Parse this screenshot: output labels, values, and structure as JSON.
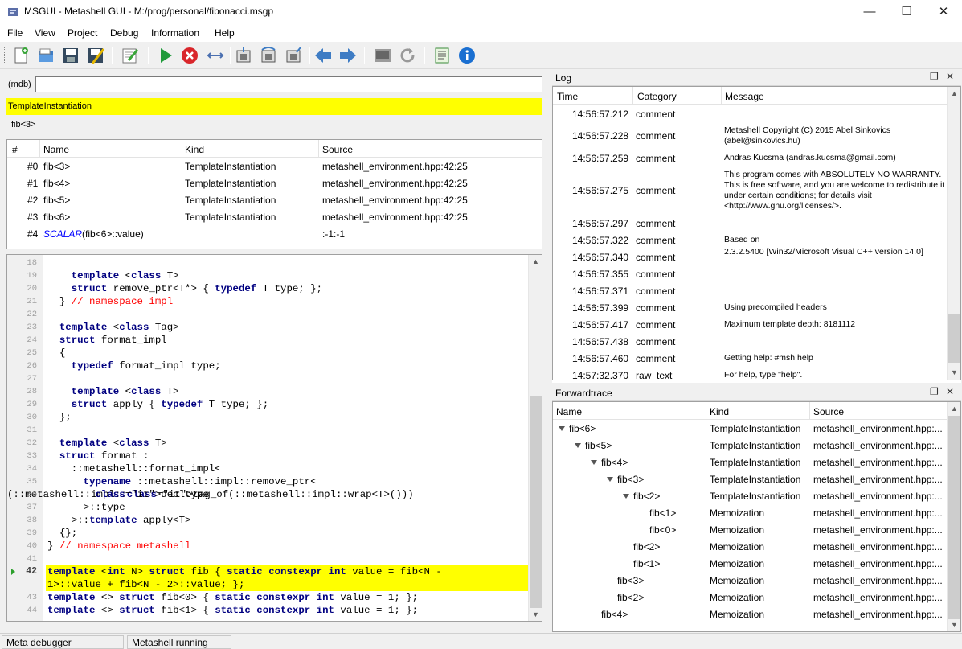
{
  "window": {
    "title": "MSGUI - Metashell GUI - M:/prog/personal/fibonacci.msgp"
  },
  "menu": [
    "File",
    "View",
    "Project",
    "Debug",
    "Information",
    "Help"
  ],
  "toolbar": {
    "icons": [
      "new-file-icon",
      "open-file-icon",
      "save-icon",
      "save-as-icon",
      "edit-icon",
      "run-icon",
      "stop-icon",
      "step-icon",
      "step-into-icon",
      "step-over-icon",
      "step-out-icon",
      "back-icon",
      "forward-icon",
      "terminal-icon",
      "refresh-icon",
      "notes-icon",
      "info-icon"
    ]
  },
  "mdb": {
    "label": "(mdb)",
    "value": ""
  },
  "current": {
    "kind": "TemplateInstantiation",
    "name": "fib<3>"
  },
  "frames": {
    "headers": [
      "#",
      "Name",
      "Kind",
      "Source"
    ],
    "rows": [
      {
        "idx": "#0",
        "name": "fib<3>",
        "kind": "TemplateInstantiation",
        "source": "metashell_environment.hpp:42:25"
      },
      {
        "idx": "#1",
        "name": "fib<4>",
        "kind": "TemplateInstantiation",
        "source": "metashell_environment.hpp:42:25"
      },
      {
        "idx": "#2",
        "name": "fib<5>",
        "kind": "TemplateInstantiation",
        "source": "metashell_environment.hpp:42:25"
      },
      {
        "idx": "#3",
        "name": "fib<6>",
        "kind": "TemplateInstantiation",
        "source": "metashell_environment.hpp:42:25"
      }
    ],
    "last_row": {
      "idx": "#4",
      "scalar": "SCALAR",
      "rest": "(fib<6>::value)",
      "source": ":-1:-1"
    }
  },
  "code": {
    "active_line": "42",
    "lines": [
      {
        "n": "18",
        "t": ""
      },
      {
        "n": "19",
        "t": "    template <class T>"
      },
      {
        "n": "20",
        "t": "    struct remove_ptr<T*> { typedef T type; };"
      },
      {
        "n": "21",
        "t": "  } // namespace impl"
      },
      {
        "n": "22",
        "t": ""
      },
      {
        "n": "23",
        "t": "  template <class Tag>"
      },
      {
        "n": "24",
        "t": "  struct format_impl"
      },
      {
        "n": "25",
        "t": "  {"
      },
      {
        "n": "26",
        "t": "    typedef format_impl type;"
      },
      {
        "n": "27",
        "t": ""
      },
      {
        "n": "28",
        "t": "    template <class T>"
      },
      {
        "n": "29",
        "t": "    struct apply { typedef T type; };"
      },
      {
        "n": "30",
        "t": "  };"
      },
      {
        "n": "31",
        "t": ""
      },
      {
        "n": "32",
        "t": "  template <class T>"
      },
      {
        "n": "33",
        "t": "  struct format :"
      },
      {
        "n": "34",
        "t": "    ::metashell::format_impl<"
      },
      {
        "n": "35",
        "t": "      typename ::metashell::impl::remove_ptr<"
      },
      {
        "n": "36",
        "t": "        decltype(::metashell::impl::tag_of(::metashell::impl::wrap<T>()))"
      },
      {
        "n": "37",
        "t": "      >::type"
      },
      {
        "n": "38",
        "t": "    >::template apply<T>"
      },
      {
        "n": "39",
        "t": "  {};"
      },
      {
        "n": "40",
        "t": "} // namespace metashell"
      },
      {
        "n": "41",
        "t": ""
      },
      {
        "n": "42",
        "t": "template <int N> struct fib { static constexpr int value = fib<N -"
      },
      {
        "n": "",
        "t": "1>::value + fib<N - 2>::value; };"
      },
      {
        "n": "43",
        "t": "template <> struct fib<0> { static constexpr int value = 1; };"
      },
      {
        "n": "44",
        "t": "template <> struct fib<1> { static constexpr int value = 1; };"
      }
    ]
  },
  "status": {
    "left": "Meta debugger",
    "right": "Metashell running"
  },
  "log": {
    "title": "Log",
    "headers": [
      "Time",
      "Category",
      "Message"
    ],
    "rows": [
      {
        "time": "14:56:57.212",
        "cat": "comment",
        "msg": ""
      },
      {
        "time": "14:56:57.228",
        "cat": "comment",
        "msg": "Metashell Copyright (C) 2015 Abel Sinkovics (abel@sinkovics.hu)"
      },
      {
        "time": "14:56:57.259",
        "cat": "comment",
        "msg": "Andras Kucsma  (andras.kucsma@gmail.com)"
      },
      {
        "time": "14:56:57.275",
        "cat": "comment",
        "msg": "This program comes with ABSOLUTELY NO WARRANTY. This is free software, and you are welcome to redistribute it under certain conditions; for details visit <http://www.gnu.org/licenses/>."
      },
      {
        "time": "14:56:57.297",
        "cat": "comment",
        "msg": ""
      },
      {
        "time": "14:56:57.322",
        "cat": "comment",
        "msg": "Based on"
      },
      {
        "time": "14:56:57.340",
        "cat": "comment",
        "msg": "2.3.2.5400 [Win32/Microsoft Visual C++ version 14.0]"
      },
      {
        "time": "14:56:57.355",
        "cat": "comment",
        "msg": ""
      },
      {
        "time": "14:56:57.371",
        "cat": "comment",
        "msg": ""
      },
      {
        "time": "14:56:57.399",
        "cat": "comment",
        "msg": "Using precompiled headers"
      },
      {
        "time": "14:56:57.417",
        "cat": "comment",
        "msg": "Maximum template depth: 8181112"
      },
      {
        "time": "14:56:57.438",
        "cat": "comment",
        "msg": ""
      },
      {
        "time": "14:56:57.460",
        "cat": "comment",
        "msg": "Getting help: #msh help"
      },
      {
        "time": "14:57:32.370",
        "cat": "raw_text",
        "msg": "For help, type \"help\"."
      }
    ]
  },
  "forwardtrace": {
    "title": "Forwardtrace",
    "headers": [
      "Name",
      "Kind",
      "Source"
    ],
    "rows": [
      {
        "name": "fib<6>",
        "kind": "TemplateInstantiation",
        "source": "metashell_environment.hpp:...",
        "depth": 0,
        "exp": true
      },
      {
        "name": "fib<5>",
        "kind": "TemplateInstantiation",
        "source": "metashell_environment.hpp:...",
        "depth": 1,
        "exp": true
      },
      {
        "name": "fib<4>",
        "kind": "TemplateInstantiation",
        "source": "metashell_environment.hpp:...",
        "depth": 2,
        "exp": true
      },
      {
        "name": "fib<3>",
        "kind": "TemplateInstantiation",
        "source": "metashell_environment.hpp:...",
        "depth": 3,
        "exp": true
      },
      {
        "name": "fib<2>",
        "kind": "TemplateInstantiation",
        "source": "metashell_environment.hpp:...",
        "depth": 4,
        "exp": true
      },
      {
        "name": "fib<1>",
        "kind": "Memoization",
        "source": "metashell_environment.hpp:...",
        "depth": 5,
        "exp": false
      },
      {
        "name": "fib<0>",
        "kind": "Memoization",
        "source": "metashell_environment.hpp:...",
        "depth": 5,
        "exp": false
      },
      {
        "name": "fib<2>",
        "kind": "Memoization",
        "source": "metashell_environment.hpp:...",
        "depth": 4,
        "exp": false
      },
      {
        "name": "fib<1>",
        "kind": "Memoization",
        "source": "metashell_environment.hpp:...",
        "depth": 4,
        "exp": false
      },
      {
        "name": "fib<3>",
        "kind": "Memoization",
        "source": "metashell_environment.hpp:...",
        "depth": 3,
        "exp": false
      },
      {
        "name": "fib<2>",
        "kind": "Memoization",
        "source": "metashell_environment.hpp:...",
        "depth": 3,
        "exp": false
      },
      {
        "name": "fib<4>",
        "kind": "Memoization",
        "source": "metashell_environment.hpp:...",
        "depth": 2,
        "exp": false
      }
    ]
  }
}
